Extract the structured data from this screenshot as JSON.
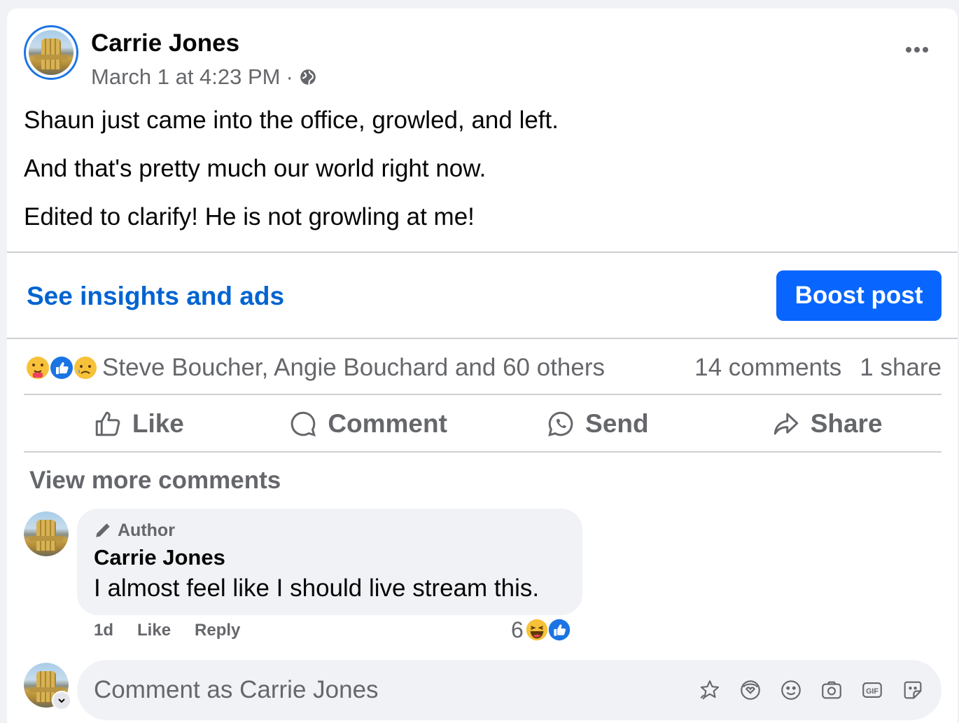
{
  "post": {
    "author": "Carrie Jones",
    "timestamp": "March 1 at 4:23 PM",
    "separator": "·",
    "privacy_icon": "globe-icon",
    "paragraphs": [
      "Shaun just came into the office, growled, and left.",
      "And that's pretty much our world right now.",
      "Edited to clarify! He is not growling at me!"
    ]
  },
  "insights": {
    "link_label": "See insights and ads",
    "boost_label": "Boost post"
  },
  "reactions": {
    "icons": [
      "care-react-icon",
      "like-react-icon",
      "sad-react-icon"
    ],
    "names": "Steve Boucher, Angie Bouchard and 60 others",
    "comments_count": "14 comments",
    "shares_count": "1 share"
  },
  "actions": {
    "like": "Like",
    "comment": "Comment",
    "send": "Send",
    "share": "Share"
  },
  "comments_section": {
    "view_more": "View more comments",
    "comment": {
      "badge": "Author",
      "author": "Carrie Jones",
      "text": "I almost feel like I should live stream this.",
      "age": "1d",
      "like": "Like",
      "reply": "Reply",
      "reaction_count": "6"
    },
    "composer_placeholder": "Comment as Carrie Jones"
  },
  "colors": {
    "accent": "#0866ff",
    "link": "#0064d1",
    "secondary_text": "#65676b",
    "bubble": "#f0f2f5"
  }
}
